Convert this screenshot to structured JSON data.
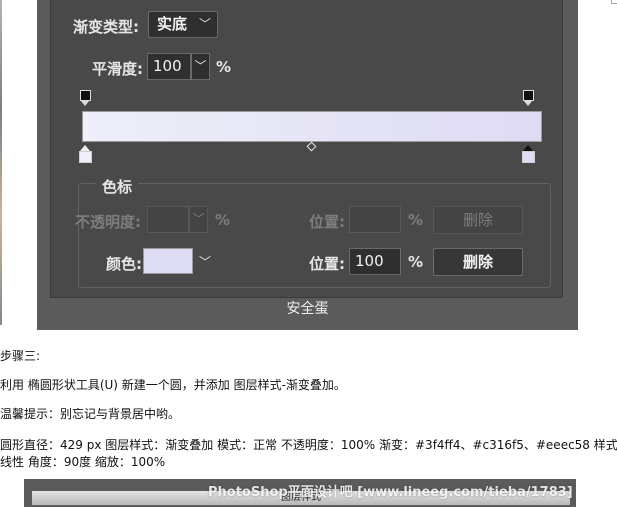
{
  "gradient_editor": {
    "gradient_type_label": "渐变类型:",
    "gradient_type_value": "实底",
    "smoothness_label": "平滑度:",
    "smoothness_value": "100",
    "smoothness_unit": "%",
    "color_stops_title": "色标",
    "opacity_label": "不透明度:",
    "opacity_unit": "%",
    "location_label": "位置:",
    "location_unit": "%",
    "delete_label": "删除",
    "color_label": "颜色:",
    "color_location_label": "位置:",
    "color_location_value": "100",
    "color_location_unit": "%",
    "color_delete_label": "删除",
    "selected_color": "#dedbf4",
    "gradient_start_color": "#eeeff8",
    "gradient_end_color": "#dedbf4",
    "caption": "安全蛋"
  },
  "text": {
    "step": "步骤三:",
    "line1": "利用 椭圆形状工具(U) 新建一个圆，并添加 图层样式-渐变叠加。",
    "tip": "温馨提示：别忘记与背景居中哟。",
    "spec_line1": "圆形直径：429 px 图层样式：渐变叠加 模式：正常 不透明度：100% 渐变：#3f4ff4、#c316f5、#eeec58 样式：",
    "spec_line2": "线性 角度：90度 缩放：100%"
  },
  "bottom": {
    "dialog_title": "图层样式",
    "watermark": "PhotoShop平面设计吧 [www.lineeg.com/tieba/1783]"
  }
}
